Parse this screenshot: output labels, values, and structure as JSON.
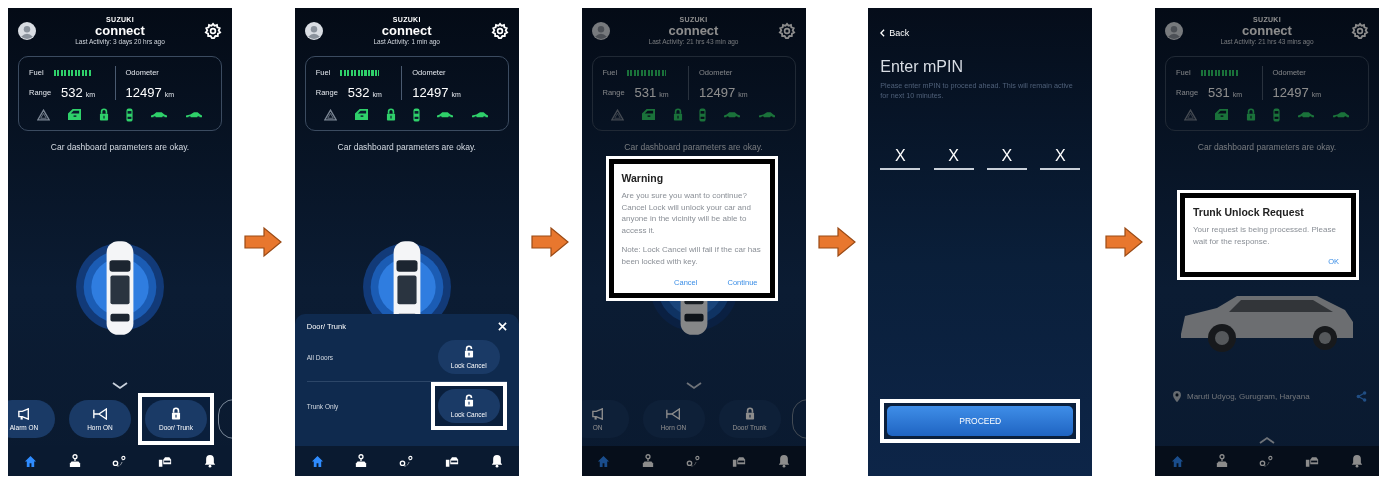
{
  "screens": [
    {
      "kind": "dashboard",
      "dimmed": false,
      "header": {
        "brand": "SUZUKI",
        "app": "connect",
        "last_activity": "Last Activity: 3 days 20 hrs ago"
      },
      "status": {
        "fuel": {
          "label": "Fuel",
          "level": 1
        },
        "range": {
          "label": "Range",
          "value": "532",
          "unit": "km"
        },
        "odometer": {
          "label": "Odometer",
          "value": "12497",
          "unit": "km"
        }
      },
      "message": "Car dashboard parameters are okay.",
      "car": {
        "photo": false
      },
      "chevron": {
        "up": false
      },
      "actions": [
        {
          "kind": "alarm",
          "label": "Alarm ON",
          "highlighted": false
        },
        {
          "kind": "horn",
          "label": "Horn ON",
          "highlighted": false
        },
        {
          "kind": "lock",
          "label": "Door/ Trunk",
          "highlighted": true
        }
      ],
      "nav_items": [
        {
          "selected": true
        },
        {
          "selected": false
        },
        {
          "selected": false
        },
        {
          "selected": false
        },
        {
          "selected": false
        }
      ]
    },
    {
      "kind": "dashboard",
      "dimmed": false,
      "header": {
        "brand": "SUZUKI",
        "app": "connect",
        "last_activity": "Last Activity: 1 min ago"
      },
      "status": {
        "fuel": {
          "label": "Fuel",
          "level": 1
        },
        "range": {
          "label": "Range",
          "value": "532",
          "unit": "km"
        },
        "odometer": {
          "label": "Odometer",
          "value": "12497",
          "unit": "km"
        }
      },
      "message": "Car dashboard parameters are okay.",
      "car": {
        "photo": false
      },
      "sheet": {
        "title": "Door/ Trunk",
        "rows": [
          {
            "label": "All Doors",
            "button": "Lock Cancel",
            "highlighted": false
          },
          {
            "label": "Trunk Only",
            "button": "Lock Cancel",
            "highlighted": true
          }
        ]
      },
      "nav_items": [
        {
          "selected": true
        },
        {
          "selected": false
        },
        {
          "selected": false
        },
        {
          "selected": false
        },
        {
          "selected": false
        }
      ]
    },
    {
      "kind": "dashboard",
      "dimmed": true,
      "header": {
        "brand": "SUZUKI",
        "app": "connect",
        "last_activity": "Last Activity: 21 hrs 43 min ago"
      },
      "status": {
        "fuel": {
          "label": "Fuel",
          "level": 1
        },
        "range": {
          "label": "Range",
          "value": "531",
          "unit": "km"
        },
        "odometer": {
          "label": "Odometer",
          "value": "12497",
          "unit": "km"
        }
      },
      "message": "Car dashboard parameters are okay.",
      "car": {
        "photo": false
      },
      "chevron": {
        "up": false
      },
      "actions": [
        {
          "kind": "alarm",
          "label": "ON",
          "highlighted": false
        },
        {
          "kind": "horn",
          "label": "Horn ON",
          "highlighted": false
        },
        {
          "kind": "lock",
          "label": "Door/ Trunk",
          "highlighted": false
        }
      ],
      "nav_items": [
        {
          "selected": true
        },
        {
          "selected": false
        },
        {
          "selected": false
        },
        {
          "selected": false
        },
        {
          "selected": false
        }
      ],
      "dialog": {
        "title": "Warning",
        "paragraphs": [
          "Are you sure you want to continue?",
          "Cancel Lock will unlock your car and anyone in the vicinity will be able to access it.",
          "Note: Lock Cancel will fail if the car has been locked with key."
        ],
        "buttons": [
          "Cancel",
          "Continue"
        ],
        "highlighted": true
      }
    },
    {
      "kind": "mpin",
      "back": "Back",
      "title": "Enter mPIN",
      "description": "Please enter mPIN to proceed ahead. This will remain active for next 10 minutes.",
      "digits": [
        "X",
        "X",
        "X",
        "X"
      ],
      "button": {
        "label": "PROCEED",
        "highlighted": true
      }
    },
    {
      "kind": "dashboard",
      "dimmed": true,
      "header": {
        "brand": "SUZUKI",
        "app": "connect",
        "last_activity": "Last Activity: 21 hrs 43 mins ago"
      },
      "status": {
        "fuel": {
          "label": "Fuel",
          "level": 1
        },
        "range": {
          "label": "Range",
          "value": "531",
          "unit": "km"
        },
        "odometer": {
          "label": "Odometer",
          "value": "12497",
          "unit": "km"
        }
      },
      "message": "Car dashboard parameters are okay.",
      "car": {
        "photo": true
      },
      "location": "Maruti Udyog, Gurugram, Haryana",
      "chevron": {
        "up": true
      },
      "nav_items": [
        {
          "selected": true
        },
        {
          "selected": false
        },
        {
          "selected": false
        },
        {
          "selected": false
        },
        {
          "selected": false
        }
      ],
      "dialog": {
        "title": "Trunk Unlock Request",
        "paragraphs": [
          "Your request is being processed. Please wait for the response."
        ],
        "buttons": [
          "OK"
        ],
        "highlighted": true
      }
    }
  ]
}
